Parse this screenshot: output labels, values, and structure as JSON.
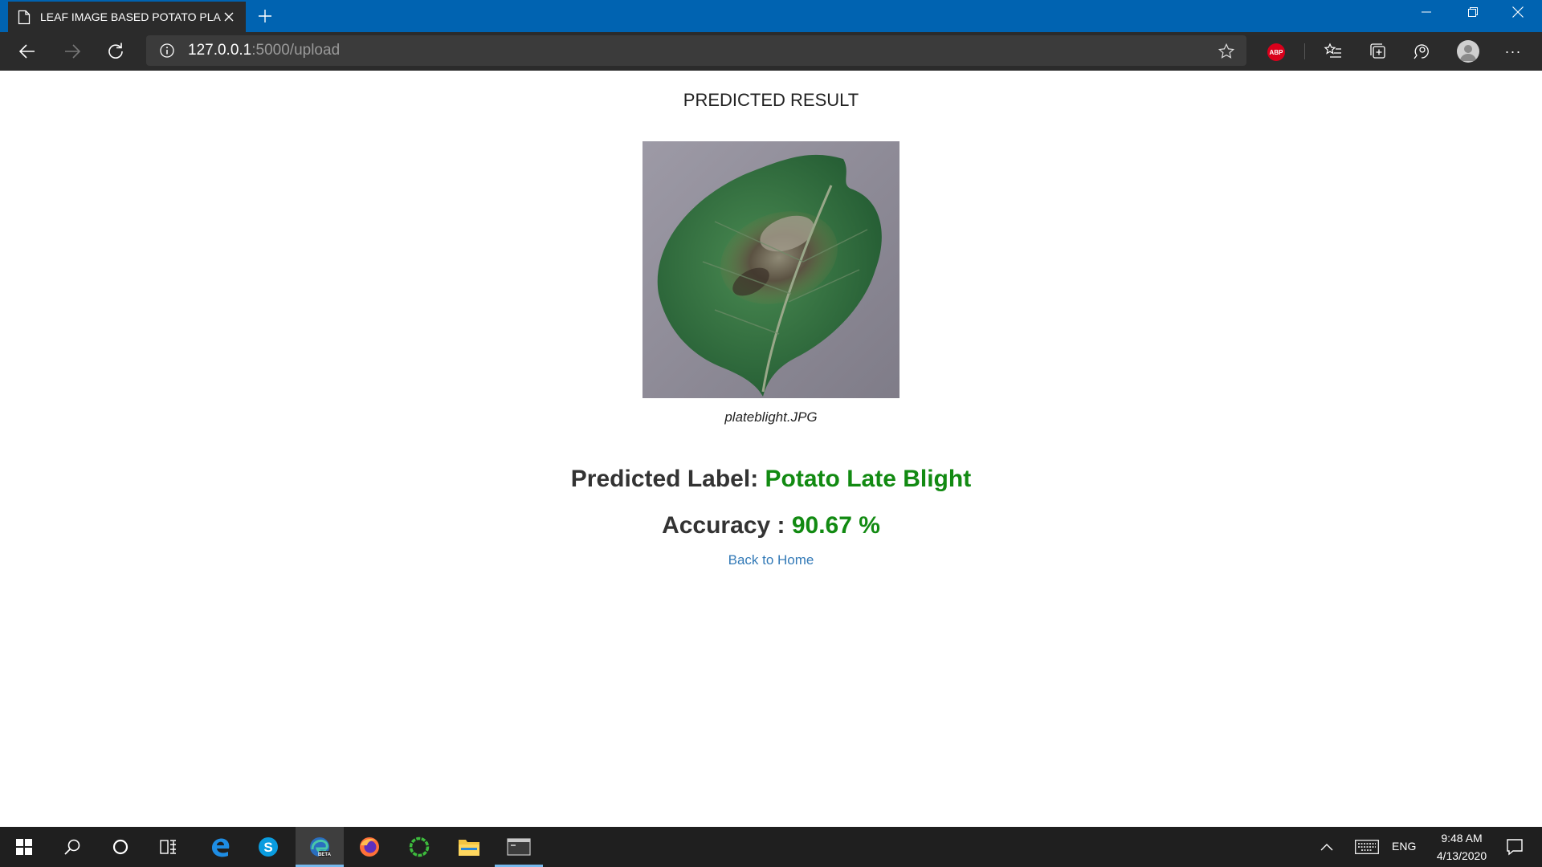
{
  "browser": {
    "tab_title": "LEAF IMAGE BASED POTATO PLA",
    "url_host": "127.0.0.1",
    "url_path": ":5000/upload",
    "abp_label": "ABP",
    "more_label": "···"
  },
  "page": {
    "heading": "PREDICTED RESULT",
    "image_caption": "plateblight.JPG",
    "predicted_label_prefix": "Predicted Label:",
    "predicted_label_value": "Potato Late Blight",
    "accuracy_prefix": "Accuracy :",
    "accuracy_value": "90.67 %",
    "back_link": "Back to Home",
    "accent_green": "#128a12",
    "link_color": "#337ab7"
  },
  "taskbar": {
    "icons": [
      "windows-start-icon",
      "search-icon",
      "cortana-icon",
      "task-view-icon",
      "edge-legacy-icon",
      "skype-icon",
      "edge-beta-icon",
      "firefox-icon",
      "green-ring-app-icon",
      "file-explorer-icon",
      "terminal-icon"
    ],
    "language": "ENG",
    "time": "9:48 AM",
    "date": "4/13/2020"
  }
}
